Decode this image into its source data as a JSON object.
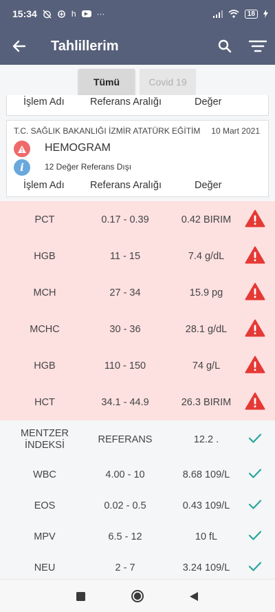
{
  "status_bar": {
    "time": "15:34",
    "icon_h": "h",
    "dots": "···",
    "battery": "18"
  },
  "app_bar": {
    "title": "Tahlillerim"
  },
  "tabs": [
    {
      "label": "Tümü",
      "selected": true
    },
    {
      "label": "Covid 19",
      "selected": false
    }
  ],
  "columns": {
    "name": "İşlem Adı",
    "range": "Referans Aralığı",
    "value": "Değer"
  },
  "card": {
    "hospital": "T.C. SAĞLIK BAKANLIĞI İZMİR ATATÜRK EĞİTİM",
    "date": "10 Mart 2021",
    "test_name": "HEMOGRAM",
    "out_of_range": "12 Değer Referans Dışı"
  },
  "results": [
    {
      "name": "PCT",
      "range": "0.17 - 0.39",
      "value": "0.42 BIRIM",
      "status": "out"
    },
    {
      "name": "HGB",
      "range": "11 - 15",
      "value": "7.4 g/dL",
      "status": "out"
    },
    {
      "name": "MCH",
      "range": "27 - 34",
      "value": "15.9 pg",
      "status": "out"
    },
    {
      "name": "MCHC",
      "range": "30 - 36",
      "value": "28.1 g/dL",
      "status": "out"
    },
    {
      "name": "HGB",
      "range": "110 - 150",
      "value": "74 g/L",
      "status": "out"
    },
    {
      "name": "HCT",
      "range": "34.1 - 44.9",
      "value": "26.3 BIRIM",
      "status": "out"
    },
    {
      "name": "MENTZER İNDEKSİ",
      "range": "REFERANS",
      "value": "12.2 .",
      "status": "ok"
    },
    {
      "name": "WBC",
      "range": "4.00 - 10",
      "value": "8.68 109/L",
      "status": "ok"
    },
    {
      "name": "EOS",
      "range": "0.02 - 0.5",
      "value": "0.43 109/L",
      "status": "ok"
    },
    {
      "name": "MPV",
      "range": "6.5 - 12",
      "value": "10 fL",
      "status": "ok"
    },
    {
      "name": "NEU",
      "range": "2 - 7",
      "value": "3.24 109/L",
      "status": "ok"
    }
  ],
  "colors": {
    "app_bar": "#56607a",
    "alert": "#e53935",
    "ok": "#26a69a",
    "out_row": "#fde0e0"
  },
  "icons": {
    "back": "arrow-left-icon",
    "search": "search-icon",
    "filter": "filter-icon",
    "alert": "warning-triangle-icon",
    "ok": "checkmark-icon",
    "info": "info-icon"
  }
}
